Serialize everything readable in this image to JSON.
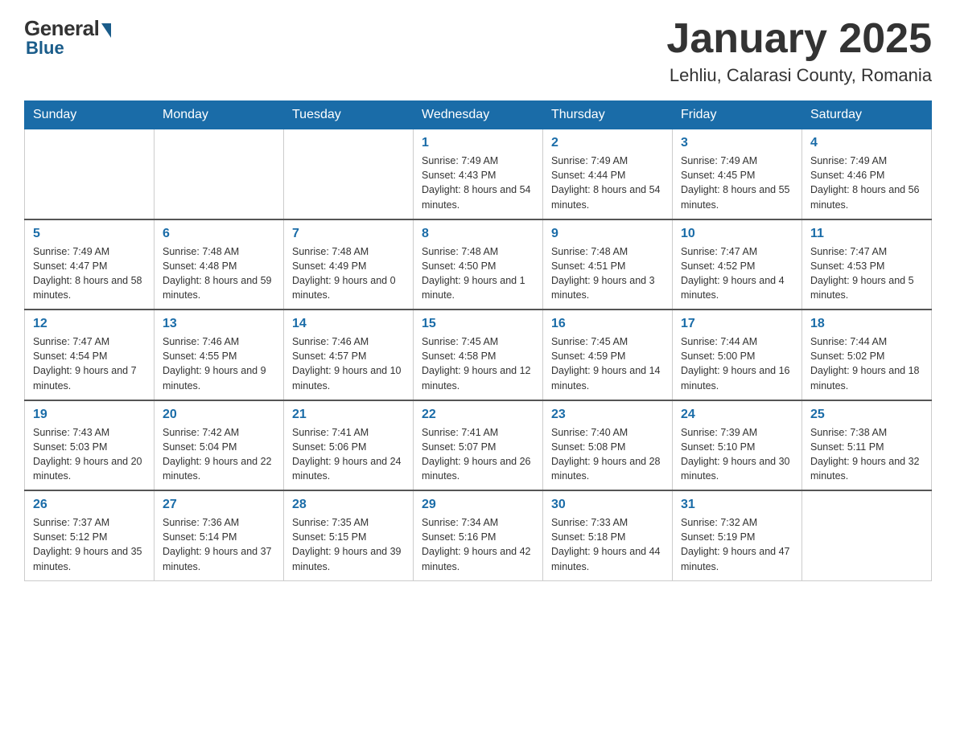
{
  "header": {
    "logo": {
      "general": "General",
      "blue": "Blue"
    },
    "title": "January 2025",
    "location": "Lehliu, Calarasi County, Romania"
  },
  "days_of_week": [
    "Sunday",
    "Monday",
    "Tuesday",
    "Wednesday",
    "Thursday",
    "Friday",
    "Saturday"
  ],
  "weeks": [
    [
      {
        "day": "",
        "info": ""
      },
      {
        "day": "",
        "info": ""
      },
      {
        "day": "",
        "info": ""
      },
      {
        "day": "1",
        "info": "Sunrise: 7:49 AM\nSunset: 4:43 PM\nDaylight: 8 hours\nand 54 minutes."
      },
      {
        "day": "2",
        "info": "Sunrise: 7:49 AM\nSunset: 4:44 PM\nDaylight: 8 hours\nand 54 minutes."
      },
      {
        "day": "3",
        "info": "Sunrise: 7:49 AM\nSunset: 4:45 PM\nDaylight: 8 hours\nand 55 minutes."
      },
      {
        "day": "4",
        "info": "Sunrise: 7:49 AM\nSunset: 4:46 PM\nDaylight: 8 hours\nand 56 minutes."
      }
    ],
    [
      {
        "day": "5",
        "info": "Sunrise: 7:49 AM\nSunset: 4:47 PM\nDaylight: 8 hours\nand 58 minutes."
      },
      {
        "day": "6",
        "info": "Sunrise: 7:48 AM\nSunset: 4:48 PM\nDaylight: 8 hours\nand 59 minutes."
      },
      {
        "day": "7",
        "info": "Sunrise: 7:48 AM\nSunset: 4:49 PM\nDaylight: 9 hours\nand 0 minutes."
      },
      {
        "day": "8",
        "info": "Sunrise: 7:48 AM\nSunset: 4:50 PM\nDaylight: 9 hours\nand 1 minute."
      },
      {
        "day": "9",
        "info": "Sunrise: 7:48 AM\nSunset: 4:51 PM\nDaylight: 9 hours\nand 3 minutes."
      },
      {
        "day": "10",
        "info": "Sunrise: 7:47 AM\nSunset: 4:52 PM\nDaylight: 9 hours\nand 4 minutes."
      },
      {
        "day": "11",
        "info": "Sunrise: 7:47 AM\nSunset: 4:53 PM\nDaylight: 9 hours\nand 5 minutes."
      }
    ],
    [
      {
        "day": "12",
        "info": "Sunrise: 7:47 AM\nSunset: 4:54 PM\nDaylight: 9 hours\nand 7 minutes."
      },
      {
        "day": "13",
        "info": "Sunrise: 7:46 AM\nSunset: 4:55 PM\nDaylight: 9 hours\nand 9 minutes."
      },
      {
        "day": "14",
        "info": "Sunrise: 7:46 AM\nSunset: 4:57 PM\nDaylight: 9 hours\nand 10 minutes."
      },
      {
        "day": "15",
        "info": "Sunrise: 7:45 AM\nSunset: 4:58 PM\nDaylight: 9 hours\nand 12 minutes."
      },
      {
        "day": "16",
        "info": "Sunrise: 7:45 AM\nSunset: 4:59 PM\nDaylight: 9 hours\nand 14 minutes."
      },
      {
        "day": "17",
        "info": "Sunrise: 7:44 AM\nSunset: 5:00 PM\nDaylight: 9 hours\nand 16 minutes."
      },
      {
        "day": "18",
        "info": "Sunrise: 7:44 AM\nSunset: 5:02 PM\nDaylight: 9 hours\nand 18 minutes."
      }
    ],
    [
      {
        "day": "19",
        "info": "Sunrise: 7:43 AM\nSunset: 5:03 PM\nDaylight: 9 hours\nand 20 minutes."
      },
      {
        "day": "20",
        "info": "Sunrise: 7:42 AM\nSunset: 5:04 PM\nDaylight: 9 hours\nand 22 minutes."
      },
      {
        "day": "21",
        "info": "Sunrise: 7:41 AM\nSunset: 5:06 PM\nDaylight: 9 hours\nand 24 minutes."
      },
      {
        "day": "22",
        "info": "Sunrise: 7:41 AM\nSunset: 5:07 PM\nDaylight: 9 hours\nand 26 minutes."
      },
      {
        "day": "23",
        "info": "Sunrise: 7:40 AM\nSunset: 5:08 PM\nDaylight: 9 hours\nand 28 minutes."
      },
      {
        "day": "24",
        "info": "Sunrise: 7:39 AM\nSunset: 5:10 PM\nDaylight: 9 hours\nand 30 minutes."
      },
      {
        "day": "25",
        "info": "Sunrise: 7:38 AM\nSunset: 5:11 PM\nDaylight: 9 hours\nand 32 minutes."
      }
    ],
    [
      {
        "day": "26",
        "info": "Sunrise: 7:37 AM\nSunset: 5:12 PM\nDaylight: 9 hours\nand 35 minutes."
      },
      {
        "day": "27",
        "info": "Sunrise: 7:36 AM\nSunset: 5:14 PM\nDaylight: 9 hours\nand 37 minutes."
      },
      {
        "day": "28",
        "info": "Sunrise: 7:35 AM\nSunset: 5:15 PM\nDaylight: 9 hours\nand 39 minutes."
      },
      {
        "day": "29",
        "info": "Sunrise: 7:34 AM\nSunset: 5:16 PM\nDaylight: 9 hours\nand 42 minutes."
      },
      {
        "day": "30",
        "info": "Sunrise: 7:33 AM\nSunset: 5:18 PM\nDaylight: 9 hours\nand 44 minutes."
      },
      {
        "day": "31",
        "info": "Sunrise: 7:32 AM\nSunset: 5:19 PM\nDaylight: 9 hours\nand 47 minutes."
      },
      {
        "day": "",
        "info": ""
      }
    ]
  ]
}
